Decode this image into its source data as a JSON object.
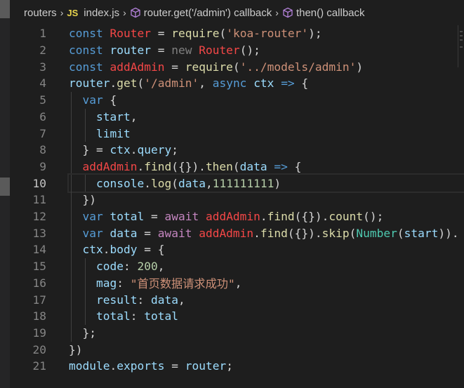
{
  "breadcrumb": {
    "folder": "routers",
    "file_badge": "JS",
    "file": "index.js",
    "symbol1": "router.get('/admin') callback",
    "symbol2": "then() callback"
  },
  "editor": {
    "current_line": 10,
    "lines": [
      {
        "n": "1",
        "tokens": [
          [
            "kw",
            "const "
          ],
          [
            "red",
            "Router"
          ],
          [
            "pun",
            " = "
          ],
          [
            "fn",
            "require"
          ],
          [
            "pun",
            "("
          ],
          [
            "str",
            "'koa-router'"
          ],
          [
            "pun",
            ");"
          ]
        ]
      },
      {
        "n": "2",
        "tokens": [
          [
            "kw",
            "const "
          ],
          [
            "var",
            "router"
          ],
          [
            "pun",
            " = "
          ],
          [
            "dim",
            "new "
          ],
          [
            "red",
            "Router"
          ],
          [
            "pun",
            "();"
          ]
        ]
      },
      {
        "n": "3",
        "tokens": [
          [
            "kw",
            "const "
          ],
          [
            "red",
            "addAdmin"
          ],
          [
            "pun",
            " = "
          ],
          [
            "fn",
            "require"
          ],
          [
            "pun",
            "("
          ],
          [
            "str",
            "'../models/admin'"
          ],
          [
            "pun",
            ")"
          ]
        ]
      },
      {
        "n": "4",
        "tokens": [
          [
            "var",
            "router"
          ],
          [
            "pun",
            "."
          ],
          [
            "fn",
            "get"
          ],
          [
            "pun",
            "("
          ],
          [
            "str",
            "'/admin'"
          ],
          [
            "pun",
            ", "
          ],
          [
            "kw",
            "async "
          ],
          [
            "var",
            "ctx"
          ],
          [
            "pun",
            " "
          ],
          [
            "kw",
            "=>"
          ],
          [
            "pun",
            " {"
          ]
        ]
      },
      {
        "n": "5",
        "tokens": [
          [
            "pun",
            "  "
          ],
          [
            "kw",
            "var"
          ],
          [
            "pun",
            " {"
          ]
        ]
      },
      {
        "n": "6",
        "tokens": [
          [
            "pun",
            "    "
          ],
          [
            "var",
            "start"
          ],
          [
            "pun",
            ","
          ]
        ]
      },
      {
        "n": "7",
        "tokens": [
          [
            "pun",
            "    "
          ],
          [
            "var",
            "limit"
          ]
        ]
      },
      {
        "n": "8",
        "tokens": [
          [
            "pun",
            "  } = "
          ],
          [
            "var",
            "ctx"
          ],
          [
            "pun",
            "."
          ],
          [
            "var",
            "query"
          ],
          [
            "pun",
            ";"
          ]
        ]
      },
      {
        "n": "9",
        "tokens": [
          [
            "pun",
            "  "
          ],
          [
            "red",
            "addAdmin"
          ],
          [
            "pun",
            "."
          ],
          [
            "fn",
            "find"
          ],
          [
            "pun",
            "({})."
          ],
          [
            "fn",
            "then"
          ],
          [
            "pun",
            "("
          ],
          [
            "var",
            "data"
          ],
          [
            "pun",
            " "
          ],
          [
            "kw",
            "=>"
          ],
          [
            "pun",
            " {"
          ]
        ]
      },
      {
        "n": "10",
        "tokens": [
          [
            "pun",
            "    "
          ],
          [
            "var",
            "console"
          ],
          [
            "pun",
            "."
          ],
          [
            "fn",
            "log"
          ],
          [
            "pun",
            "("
          ],
          [
            "var",
            "data"
          ],
          [
            "pun",
            ","
          ],
          [
            "num",
            "111111111"
          ],
          [
            "pun",
            ")"
          ]
        ]
      },
      {
        "n": "11",
        "tokens": [
          [
            "pun",
            "  })"
          ]
        ]
      },
      {
        "n": "12",
        "tokens": [
          [
            "pun",
            "  "
          ],
          [
            "kw",
            "var "
          ],
          [
            "var",
            "total"
          ],
          [
            "pun",
            " = "
          ],
          [
            "ctl",
            "await "
          ],
          [
            "red",
            "addAdmin"
          ],
          [
            "pun",
            "."
          ],
          [
            "fn",
            "find"
          ],
          [
            "pun",
            "({})."
          ],
          [
            "fn",
            "count"
          ],
          [
            "pun",
            "();"
          ]
        ]
      },
      {
        "n": "13",
        "tokens": [
          [
            "pun",
            "  "
          ],
          [
            "kw",
            "var "
          ],
          [
            "var",
            "data"
          ],
          [
            "pun",
            " = "
          ],
          [
            "ctl",
            "await "
          ],
          [
            "red",
            "addAdmin"
          ],
          [
            "pun",
            "."
          ],
          [
            "fn",
            "find"
          ],
          [
            "pun",
            "({})."
          ],
          [
            "fn",
            "skip"
          ],
          [
            "pun",
            "("
          ],
          [
            "cls",
            "Number"
          ],
          [
            "pun",
            "("
          ],
          [
            "var",
            "start"
          ],
          [
            "pun",
            ")). "
          ]
        ]
      },
      {
        "n": "14",
        "tokens": [
          [
            "pun",
            "  "
          ],
          [
            "var",
            "ctx"
          ],
          [
            "pun",
            "."
          ],
          [
            "var",
            "body"
          ],
          [
            "pun",
            " = {"
          ]
        ]
      },
      {
        "n": "15",
        "tokens": [
          [
            "pun",
            "    "
          ],
          [
            "var",
            "code"
          ],
          [
            "pun",
            ": "
          ],
          [
            "num",
            "200"
          ],
          [
            "pun",
            ","
          ]
        ]
      },
      {
        "n": "16",
        "tokens": [
          [
            "pun",
            "    "
          ],
          [
            "var",
            "mag"
          ],
          [
            "pun",
            ": "
          ],
          [
            "str",
            "\"首页数据请求成功\""
          ],
          [
            "pun",
            ","
          ]
        ]
      },
      {
        "n": "17",
        "tokens": [
          [
            "pun",
            "    "
          ],
          [
            "var",
            "result"
          ],
          [
            "pun",
            ": "
          ],
          [
            "var",
            "data"
          ],
          [
            "pun",
            ","
          ]
        ]
      },
      {
        "n": "18",
        "tokens": [
          [
            "pun",
            "    "
          ],
          [
            "var",
            "total"
          ],
          [
            "pun",
            ": "
          ],
          [
            "var",
            "total"
          ]
        ]
      },
      {
        "n": "19",
        "tokens": [
          [
            "pun",
            "  };"
          ]
        ]
      },
      {
        "n": "20",
        "tokens": [
          [
            "pun",
            "})"
          ]
        ]
      },
      {
        "n": "21",
        "tokens": [
          [
            "var",
            "module"
          ],
          [
            "pun",
            "."
          ],
          [
            "var",
            "exports"
          ],
          [
            "pun",
            " = "
          ],
          [
            "var",
            "router"
          ],
          [
            "pun",
            ";"
          ]
        ]
      }
    ]
  },
  "colors": {
    "kw": "#569cd6",
    "var": "#9cdcfe",
    "fn": "#dcdcaa",
    "str": "#ce9178",
    "num": "#b5cea8",
    "cls": "#4ec9b0",
    "ctl": "#c586c0",
    "red": "#f44747",
    "pun": "#d4d4d4",
    "dim": "#808080"
  },
  "icons": {
    "symbol": "cube-icon",
    "chevron": "chevron-right-icon"
  }
}
